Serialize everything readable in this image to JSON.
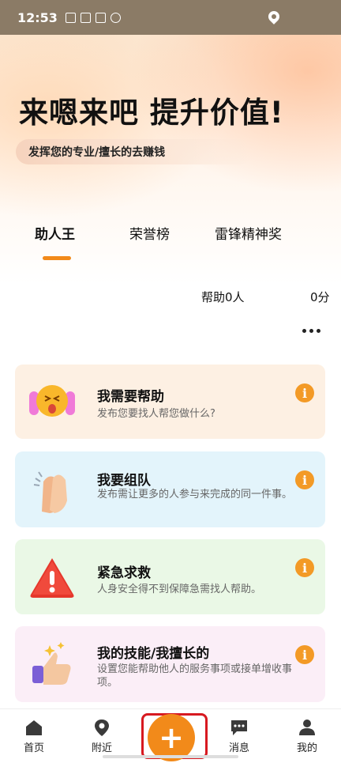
{
  "status_bar": {
    "time": "12:53"
  },
  "hero": {
    "title": "来嗯来吧 提升价值!",
    "subtitle": "发挥您的专业/擅长的去赚钱"
  },
  "tabs": [
    {
      "label": "助人王"
    },
    {
      "label": "荣誉榜"
    },
    {
      "label": "雷锋精神奖"
    }
  ],
  "stats": {
    "help_count": "帮助0人",
    "points": "0分"
  },
  "cards": [
    {
      "title": "我需要帮助",
      "desc": "发布您要找人帮您做什么?",
      "bg": "#fdf0e3",
      "icon": "crying-face-icon"
    },
    {
      "title": "我要组队",
      "desc": "发布需让更多的人参与来完成的同一件事。",
      "bg": "#e3f4fb",
      "icon": "clapping-hands-icon"
    },
    {
      "title": "紧急求救",
      "desc": "人身安全得不到保障急需找人帮助。",
      "bg": "#eaf8e6",
      "icon": "warning-triangle-icon"
    },
    {
      "title": "我的技能/我擅长的",
      "desc": "设置您能帮助他人的服务事项或接单增收事项。",
      "bg": "#fbeef7",
      "icon": "thumbs-up-icon"
    }
  ],
  "info_glyph": "i",
  "bottom_nav": {
    "home": "首页",
    "nearby": "附近",
    "plus": "+",
    "messages": "消息",
    "mine": "我的"
  },
  "colors": {
    "accent": "#f28a1a",
    "highlight_box": "#d71920"
  }
}
